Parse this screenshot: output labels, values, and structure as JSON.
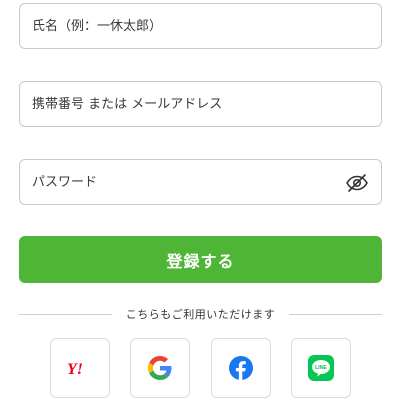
{
  "form": {
    "name_placeholder": "氏名（例：一休太郎）",
    "contact_placeholder": "携帯番号 または メールアドレス",
    "password_placeholder": "パスワード"
  },
  "register_label": "登録する",
  "divider_text": "こちらもご利用いただけます",
  "social": {
    "yahoo_icon": "yahoo-icon",
    "google_icon": "google-icon",
    "facebook_icon": "facebook-icon",
    "line_icon": "line-icon",
    "yahoo_mark": "Y!",
    "line_mark": "LINE"
  },
  "colors": {
    "register_button": "#4fb536",
    "yahoo": "#e60012",
    "facebook": "#1877f2",
    "line": "#06c755"
  }
}
